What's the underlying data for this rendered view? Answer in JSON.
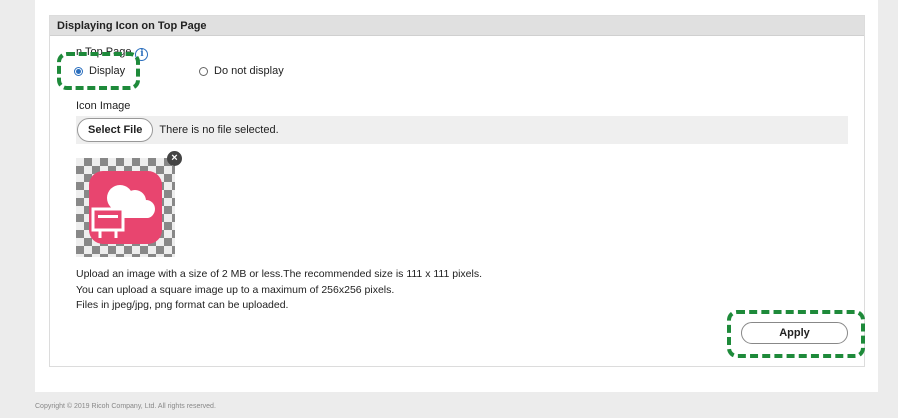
{
  "section": {
    "title": "Displaying Icon on Top Page",
    "field_label": "n Top Page",
    "info_glyph": "i",
    "radio_options": [
      {
        "label": "Display",
        "checked": true
      },
      {
        "label": "Do not display",
        "checked": false
      }
    ],
    "icon_image_label": "Icon Image",
    "select_file_label": "Select File",
    "no_file_text": "There is no file selected.",
    "remove_glyph": "×",
    "help_lines": [
      "Upload an image with a size of 2 MB or less.The recommended size is 111 x 111 pixels.",
      "You can upload a square image up to a maximum of 256x256 pixels.",
      "Files in jpeg/jpg, png format can be uploaded."
    ],
    "apply_label": "Apply"
  },
  "footer": {
    "copyright": "Copyright © 2019 Ricoh Company, Ltd. All rights reserved."
  },
  "colors": {
    "accent": "#2a6ebd",
    "highlight": "#1e8a3a",
    "app_icon": "#e8456f"
  },
  "icons": {
    "app_icon": "cloud-whiteboard-icon"
  }
}
